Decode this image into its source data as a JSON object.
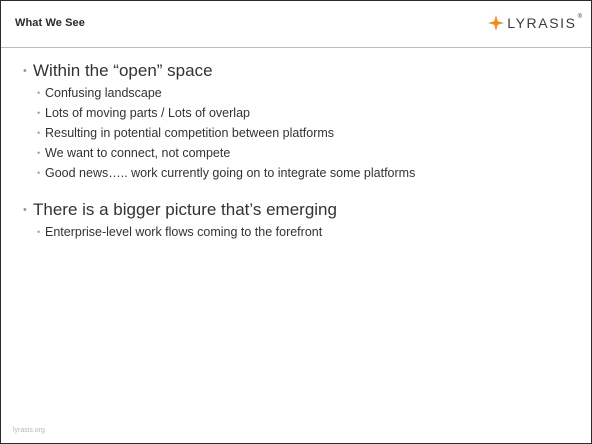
{
  "header": {
    "title": "What We See",
    "brand": {
      "name": "LYRASIS",
      "mark": "®",
      "star_color": "#f28c1e"
    }
  },
  "bullets": [
    {
      "text": "Within the “open” space",
      "subs": [
        "Confusing landscape",
        "Lots of moving parts / Lots of overlap",
        "Resulting in potential competition between platforms",
        "We want to connect, not compete",
        "Good news….. work currently going on to integrate some platforms"
      ]
    },
    {
      "text": "There is a bigger picture that’s emerging",
      "subs": [
        "Enterprise-level work flows coming to the forefront"
      ]
    }
  ],
  "bullet_glyph": "•",
  "footer": {
    "text": "lyrasis.org"
  }
}
